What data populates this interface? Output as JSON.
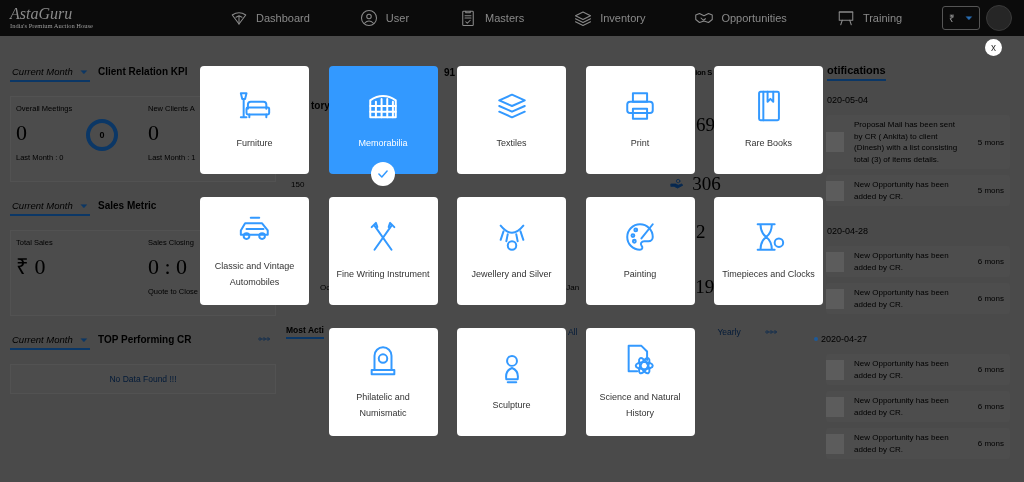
{
  "nav": {
    "logo": "AstaGuru",
    "tagline": "India's Premium Auction House",
    "items": [
      {
        "label": "Dashboard"
      },
      {
        "label": "User"
      },
      {
        "label": "Masters"
      },
      {
        "label": "Inventory"
      },
      {
        "label": "Opportunities"
      },
      {
        "label": "Training"
      }
    ],
    "currency": "₹"
  },
  "left": {
    "sections": [
      {
        "kind": "kpi",
        "period": "Current Month",
        "title": "Client Relation KPI",
        "metrics": [
          {
            "label": "Overall Meetings",
            "value": "0",
            "footnote": "Last Month : 0",
            "ring": "0"
          },
          {
            "label": "New Clients A",
            "value": "0",
            "footnote": "Last Month : 1"
          }
        ]
      },
      {
        "kind": "kpi",
        "period": "Current Month",
        "title": "Sales Metric",
        "metrics": [
          {
            "label": "Total Sales",
            "value": "₹ 0"
          },
          {
            "label": "Sales Closing",
            "value": "0 : 0",
            "footnote": "Quote to Close"
          }
        ]
      },
      {
        "kind": "list",
        "period": "Current Month",
        "title": "TOP Performing CR",
        "empty_text": "No Data Found !!!"
      }
    ]
  },
  "analytics": {
    "count": "91",
    "summary_title": "ion S",
    "chart_title": "tory",
    "y_tick": "150",
    "x_labels": [
      "Oc",
      "Jan"
    ],
    "stats": [
      "69",
      "306",
      "2",
      "19"
    ]
  },
  "most_active": {
    "title": "Most Acti",
    "filters": [
      "All",
      "Yearly"
    ]
  },
  "notifications": {
    "title": "otifications",
    "groups": [
      {
        "date": "020-05-04",
        "bullet": false,
        "items": [
          {
            "text": "Proposal Mail has been sent by CR ( Ankita) to client (Dinesh) with a list consisting total (3) of items details.",
            "time": "5 mons"
          },
          {
            "text": "New Opportunity has been added by CR.",
            "time": "5 mons"
          }
        ]
      },
      {
        "date": "020-04-28",
        "bullet": false,
        "items": [
          {
            "text": "New Opportunity has been added by CR.",
            "time": "6 mons"
          },
          {
            "text": "New Opportunity has been added by CR.",
            "time": "6 mons"
          }
        ]
      },
      {
        "date": "2020-04-27",
        "bullet": true,
        "items": [
          {
            "text": "New Opportunity has been added by CR.",
            "time": "6 mons"
          },
          {
            "text": "New Opportunity has been added by CR.",
            "time": "6 mons"
          },
          {
            "text": "New Opportunity has been added by CR.",
            "time": "6 mons"
          }
        ]
      }
    ]
  },
  "modal": {
    "close": "x",
    "categories": [
      {
        "label": "Furniture",
        "selected": false
      },
      {
        "label": "Memorabilia",
        "selected": true
      },
      {
        "label": "Textiles",
        "selected": false
      },
      {
        "label": "Print",
        "selected": false
      },
      {
        "label": "Rare Books",
        "selected": false
      },
      {
        "label": "Classic and Vintage Automobiles",
        "selected": false
      },
      {
        "label": "Fine Writing Instrument",
        "selected": false
      },
      {
        "label": "Jewellery and Silver",
        "selected": false
      },
      {
        "label": "Painting",
        "selected": false
      },
      {
        "label": "Timepieces and Clocks",
        "selected": false
      },
      {
        "label": "Philatelic and Numismatic",
        "selected": false
      },
      {
        "label": "Sculpture",
        "selected": false
      },
      {
        "label": "Science and Natural History",
        "selected": false
      }
    ]
  }
}
